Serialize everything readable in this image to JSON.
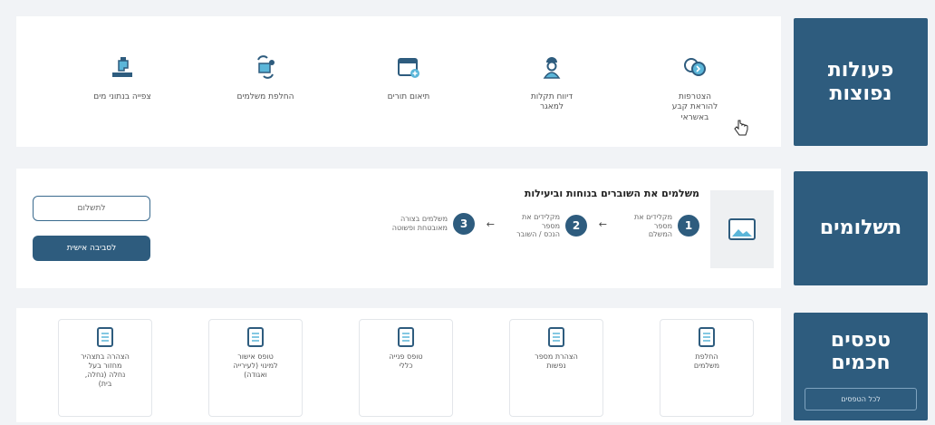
{
  "sections": {
    "actions": {
      "title": "פעולות\nנפוצות",
      "items": [
        {
          "label": "הצטרפות\nלהוראת קבע\nבאשראי",
          "icon": "card-sync-icon"
        },
        {
          "label": "דיווח תקלות\nלמאגר",
          "icon": "worker-icon"
        },
        {
          "label": "תיאום תורים",
          "icon": "calendar-icon"
        },
        {
          "label": "החלפת משלמים",
          "icon": "swap-people-icon"
        },
        {
          "label": "צפייה בנתוני מים",
          "icon": "water-tap-icon"
        }
      ]
    },
    "payments": {
      "title": "תשלומים",
      "heading": "משלמים את השוברים בנוחות וביעילות",
      "steps": [
        {
          "num": "1",
          "text": "מקלידים את מספר\nהמשלם"
        },
        {
          "num": "2",
          "text": "מקלידים את מספר\nהנכס / השובר"
        },
        {
          "num": "3",
          "text": "משלמים בצורה\nמאובטחת ופשוטה"
        }
      ],
      "arrow": "←",
      "pay_button": "לתשלום",
      "personal_button": "לסביבה אישית"
    },
    "forms": {
      "title": "טפסים\nחכמים",
      "all_button": "לכל הטפסים",
      "items": [
        {
          "label": "החלפת\nמשלמים"
        },
        {
          "label": "הצהרת מספר\nנפשות"
        },
        {
          "label": "טופס פנייה\nכללי"
        },
        {
          "label": "טופס אישור\nלמינוי (לעירייה\nואגודה)"
        },
        {
          "label": "הצהרה בתצהיר\nמחזור בעל\nנחלה (נחלה,\nבית)"
        }
      ]
    }
  }
}
